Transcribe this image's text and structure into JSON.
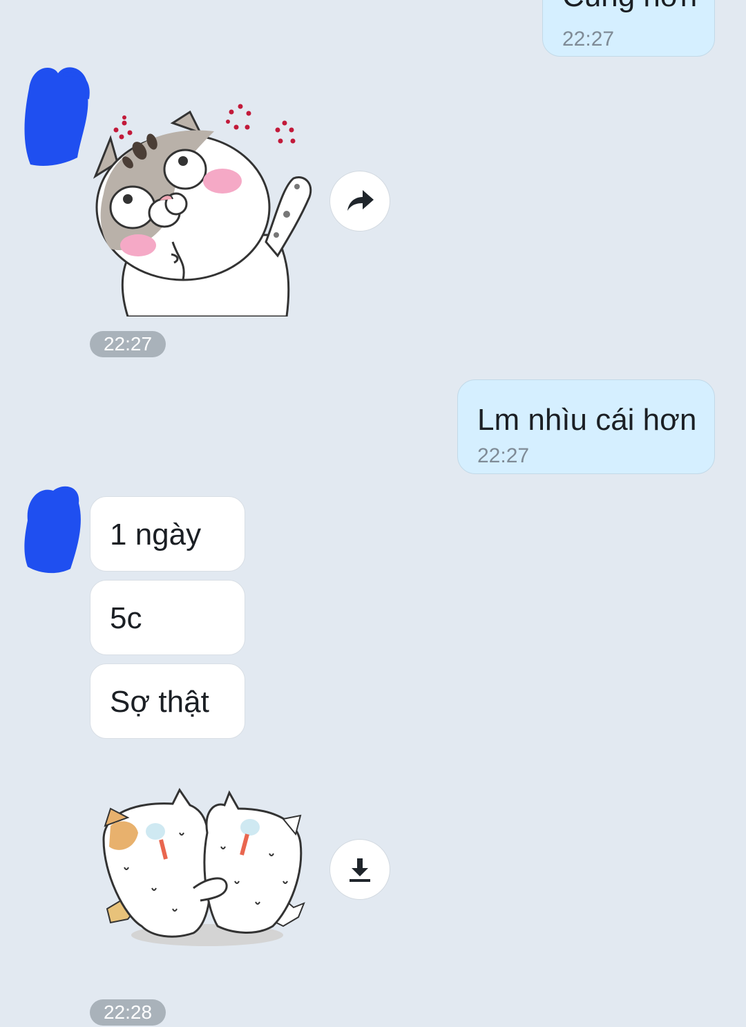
{
  "messages": [
    {
      "side": "out",
      "text": "Cũng hơn",
      "time": "22:27"
    },
    {
      "side": "in",
      "type": "sticker",
      "sticker_icon": "cat-blushing-sticker",
      "action_icon": "forward-icon",
      "time": "22:27"
    },
    {
      "side": "out",
      "text": "Lm nhìu cái hơn",
      "time": "22:27"
    },
    {
      "side": "in",
      "text": "1 ngày"
    },
    {
      "side": "in",
      "text": "5c"
    },
    {
      "side": "in",
      "text": "Sợ thật"
    },
    {
      "side": "in",
      "type": "sticker",
      "sticker_icon": "two-scared-cats-sticker",
      "action_icon": "download-icon",
      "time": "22:28"
    }
  ],
  "colors": {
    "background": "#e2e9f1",
    "outgoing_bubble": "#d5efff",
    "incoming_bubble": "#ffffff",
    "time_pill": "#a9b2ba",
    "redaction": "#1f4ff0"
  }
}
